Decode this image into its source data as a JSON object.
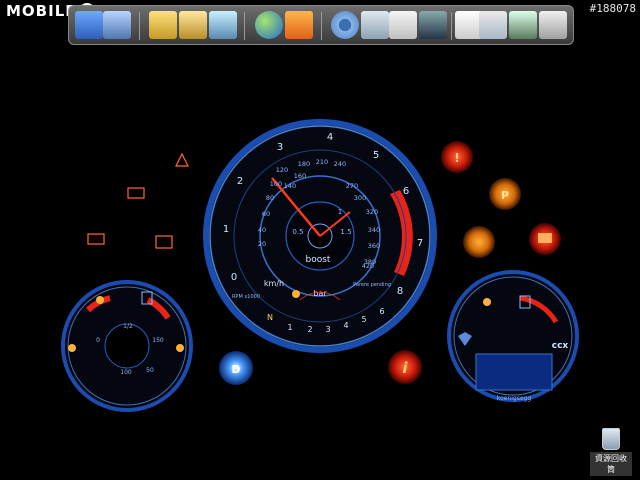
{
  "watermark": {
    "text": "MOBILE",
    "suffix": "01"
  },
  "post_id": "#188078",
  "dock": {
    "icons": [
      "computer-icon",
      "network-icon",
      "folder-icon",
      "documents-folder-icon",
      "pictures-folder-icon",
      "internet-globe-icon",
      "media-player-icon",
      "settings-gear-icon",
      "recycle-bin-icon",
      "window-thumbnail-icon",
      "app-thumbnail-icon",
      "doc-thumbnail-icon",
      "window-preview-1-icon",
      "window-preview-2-icon",
      "window-preview-3-icon"
    ]
  },
  "gauge": {
    "rpm_ticks": [
      "0",
      "1",
      "2",
      "3",
      "4",
      "5",
      "6",
      "7",
      "8"
    ],
    "speed_ticks": [
      "20",
      "40",
      "60",
      "80",
      "100",
      "120",
      "140",
      "160",
      "180",
      "210",
      "240",
      "270",
      "300",
      "320",
      "340",
      "360",
      "380",
      "420"
    ],
    "boost_ticks": [
      "0.5",
      "1",
      "1.5"
    ],
    "labels": {
      "kmh": "km/h",
      "rpm": "RPM x1000",
      "boost": "boost",
      "bar": "bar",
      "gear": "N",
      "park": "Parere pending"
    },
    "gears": [
      "1",
      "2",
      "3",
      "4",
      "5",
      "6"
    ],
    "mini_gauge": {
      "title": "boost",
      "ticks": [
        "0",
        "1",
        "2"
      ],
      "value": "0.5"
    }
  },
  "left_cluster": {
    "ticks": [
      "1/2",
      "0",
      "150",
      "100",
      "50"
    ]
  },
  "right_cluster": {
    "brand": "ccx",
    "display": "koenigsegg"
  },
  "recycle_bin": {
    "label": "資源回收筒"
  },
  "colors": {
    "accent_blue": "#2f7bff",
    "warning_red": "#ff3a1a",
    "amber": "#ff8c1a"
  }
}
